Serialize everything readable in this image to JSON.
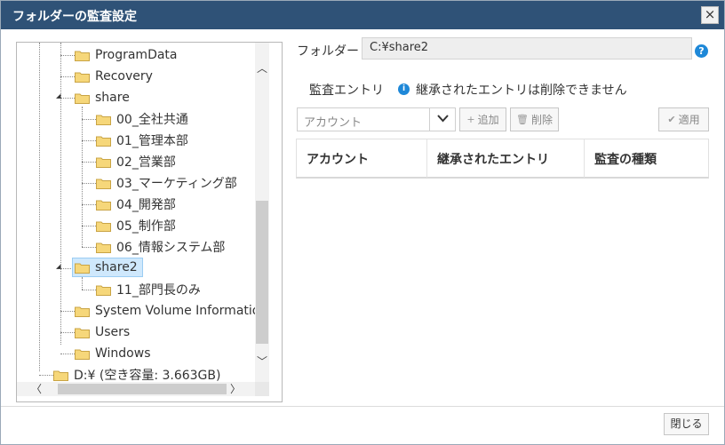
{
  "dialog": {
    "title": "フォルダーの監査設定",
    "close_icon": "×"
  },
  "tree": {
    "items": [
      {
        "label": "ProgramData"
      },
      {
        "label": "Recovery"
      },
      {
        "label": "share"
      },
      {
        "label": "00_全社共通"
      },
      {
        "label": "01_管理本部"
      },
      {
        "label": "02_営業部"
      },
      {
        "label": "03_マーケティング部"
      },
      {
        "label": "04_開発部"
      },
      {
        "label": "05_制作部"
      },
      {
        "label": "06_情報システム部"
      },
      {
        "label": "share2",
        "selected": true
      },
      {
        "label": "11_部門長のみ"
      },
      {
        "label": "System Volume Information"
      },
      {
        "label": "Users"
      },
      {
        "label": "Windows"
      },
      {
        "label": "D:¥ (空き容量: 3.663GB)"
      }
    ],
    "scroll_up": "︿",
    "scroll_down": "﹀",
    "scroll_left": "〈",
    "scroll_right": "〉"
  },
  "folder": {
    "label": "フォルダー",
    "path": "C:¥share2",
    "help_icon": "?"
  },
  "audit": {
    "section_title": "監査エントリ",
    "info_icon": "i",
    "info_text": "継承されたエントリは削除できません",
    "account_placeholder": "アカウント",
    "dropdown_chevron": "⌄",
    "add_label": "追加",
    "add_icon": "+",
    "delete_label": "削除",
    "delete_icon": "🗑",
    "apply_label": "適用",
    "apply_icon": "✔"
  },
  "table": {
    "columns": [
      "アカウント",
      "継承されたエントリ",
      "監査の種類"
    ]
  },
  "footer": {
    "close_label": "閉じる"
  },
  "colors": {
    "titlebar": "#2f5277",
    "selected_bg": "#cfe8fc",
    "info_blue": "#1e88d8",
    "folder_yellow": "#f6d77a"
  }
}
